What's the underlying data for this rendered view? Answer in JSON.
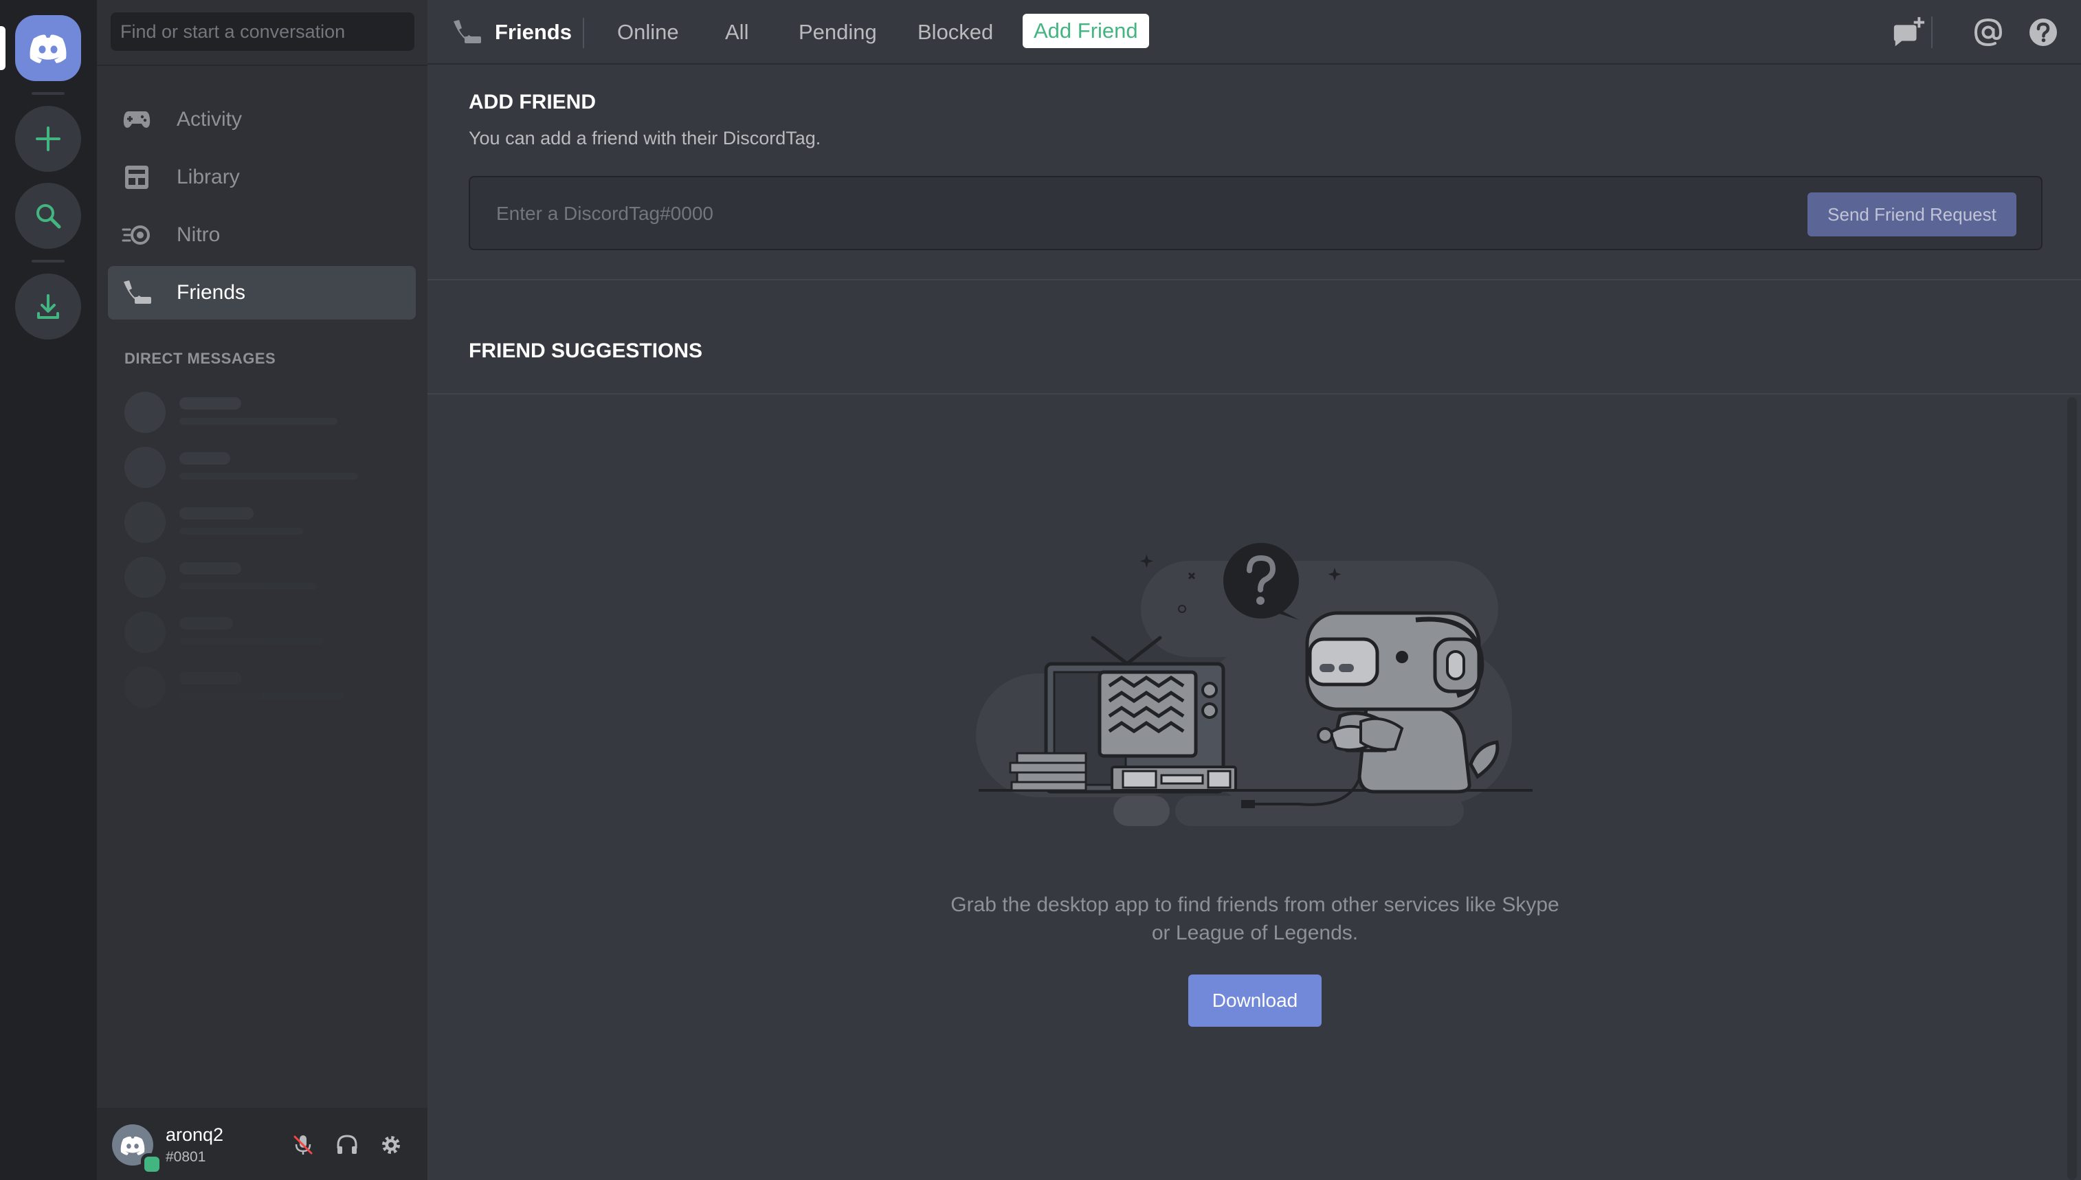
{
  "search": {
    "placeholder": "Find or start a conversation"
  },
  "nav": {
    "items": [
      {
        "label": "Activity"
      },
      {
        "label": "Library"
      },
      {
        "label": "Nitro"
      },
      {
        "label": "Friends"
      }
    ]
  },
  "dm": {
    "header": "DIRECT MESSAGES"
  },
  "user": {
    "name": "aronq2",
    "tag": "#0801"
  },
  "topbar": {
    "title": "Friends",
    "tabs": [
      "Online",
      "All",
      "Pending",
      "Blocked"
    ],
    "add_friend": "Add Friend"
  },
  "add_friend": {
    "title": "ADD FRIEND",
    "subtitle": "You can add a friend with their DiscordTag.",
    "input_placeholder": "Enter a DiscordTag#0000",
    "send_label": "Send Friend Request"
  },
  "suggestions": {
    "title": "FRIEND SUGGESTIONS",
    "empty_line1": "Grab the desktop app to find friends from other services like Skype",
    "empty_line2": "or League of Legends.",
    "download_label": "Download"
  },
  "colors": {
    "blurple": "#7289da",
    "green": "#43b581",
    "bg_primary": "#36393f",
    "bg_secondary": "#2f3136",
    "bg_tertiary": "#202225"
  }
}
